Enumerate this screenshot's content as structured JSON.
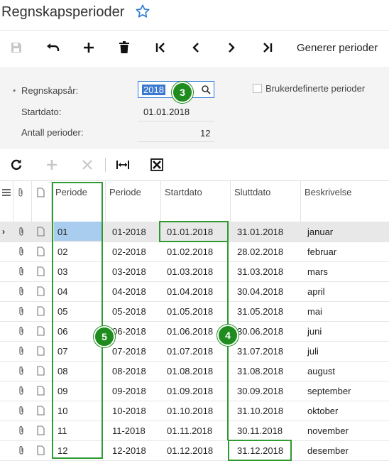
{
  "page": {
    "title": "Regnskapsperioder"
  },
  "toolbar": {
    "generate_label": "Generer perioder"
  },
  "form": {
    "fiscal_year_label": "Regnskapsår:",
    "fiscal_year_value": "2018",
    "start_date_label": "Startdato:",
    "start_date_value": "01.01.2018",
    "num_periods_label": "Antall perioder:",
    "num_periods_value": "12",
    "custom_periods_label": "Brukerdefinerte perioder",
    "required_marker": "*"
  },
  "grid": {
    "columns": [
      "Periode",
      "Periode",
      "Startdato",
      "Sluttdato",
      "Beskrivelse"
    ],
    "rows": [
      {
        "p": "01",
        "id": "01-2018",
        "start": "01.01.2018",
        "end": "31.01.2018",
        "desc": "januar"
      },
      {
        "p": "02",
        "id": "02-2018",
        "start": "01.02.2018",
        "end": "28.02.2018",
        "desc": "februar"
      },
      {
        "p": "03",
        "id": "03-2018",
        "start": "01.03.2018",
        "end": "31.03.2018",
        "desc": "mars"
      },
      {
        "p": "04",
        "id": "04-2018",
        "start": "01.04.2018",
        "end": "30.04.2018",
        "desc": "april"
      },
      {
        "p": "05",
        "id": "05-2018",
        "start": "01.05.2018",
        "end": "31.05.2018",
        "desc": "mai"
      },
      {
        "p": "06",
        "id": "06-2018",
        "start": "01.06.2018",
        "end": "30.06.2018",
        "desc": "juni"
      },
      {
        "p": "07",
        "id": "07-2018",
        "start": "01.07.2018",
        "end": "31.07.2018",
        "desc": "juli"
      },
      {
        "p": "08",
        "id": "08-2018",
        "start": "01.08.2018",
        "end": "31.08.2018",
        "desc": "august"
      },
      {
        "p": "09",
        "id": "09-2018",
        "start": "01.09.2018",
        "end": "30.09.2018",
        "desc": "september"
      },
      {
        "p": "10",
        "id": "10-2018",
        "start": "01.10.2018",
        "end": "31.10.2018",
        "desc": "oktober"
      },
      {
        "p": "11",
        "id": "11-2018",
        "start": "01.11.2018",
        "end": "30.11.2018",
        "desc": "november"
      },
      {
        "p": "12",
        "id": "12-2018",
        "start": "01.12.2018",
        "end": "31.12.2018",
        "desc": "desember"
      }
    ]
  },
  "annotations": {
    "badge_3": "3",
    "badge_4": "4",
    "badge_5": "5"
  },
  "colors": {
    "annotation": "#2f9a2f",
    "selection": "#a8cdef",
    "accent": "#2d7bd4"
  }
}
